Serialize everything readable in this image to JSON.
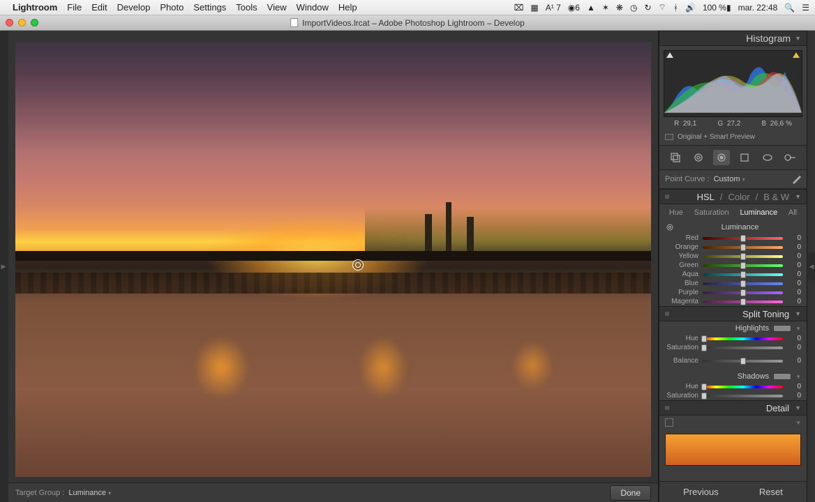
{
  "menubar": {
    "app_name": "Lightroom",
    "items": [
      "File",
      "Edit",
      "Develop",
      "Photo",
      "Settings",
      "Tools",
      "View",
      "Window",
      "Help"
    ],
    "status": {
      "badge1_label": "A¹ 7",
      "badge2_label": "6",
      "battery": "100 %",
      "clock": "mar. 22:48"
    }
  },
  "titlebar": {
    "title": "ImportVideos.lrcat – Adobe Photoshop Lightroom – Develop"
  },
  "image_footer": {
    "target_group_label": "Target Group :",
    "target_group_value": "Luminance",
    "done": "Done"
  },
  "panel_footer": {
    "previous": "Previous",
    "reset": "Reset"
  },
  "histogram": {
    "title": "Histogram",
    "readout": {
      "r_label": "R",
      "r": "29,1",
      "g_label": "G",
      "g": "27,2",
      "b_label": "B",
      "b": "26,6 %"
    },
    "preview_mode": "Original + Smart Preview"
  },
  "point_curve": {
    "label": "Point Curve :",
    "value": "Custom"
  },
  "hsl": {
    "hsl": "HSL",
    "color": "Color",
    "bw": "B & W",
    "tabs": {
      "hue": "Hue",
      "saturation": "Saturation",
      "luminance": "Luminance",
      "all": "All"
    },
    "subhead": "Luminance",
    "sliders": [
      {
        "name": "Red",
        "value": "0",
        "grad": "grad-red"
      },
      {
        "name": "Orange",
        "value": "0",
        "grad": "grad-orange"
      },
      {
        "name": "Yellow",
        "value": "0",
        "grad": "grad-yellow"
      },
      {
        "name": "Green",
        "value": "0",
        "grad": "grad-green"
      },
      {
        "name": "Aqua",
        "value": "0",
        "grad": "grad-aqua"
      },
      {
        "name": "Blue",
        "value": "0",
        "grad": "grad-blue"
      },
      {
        "name": "Purple",
        "value": "0",
        "grad": "grad-purple"
      },
      {
        "name": "Magenta",
        "value": "0",
        "grad": "grad-magenta"
      }
    ]
  },
  "split_toning": {
    "title": "Split Toning",
    "highlights": "Highlights",
    "shadows": "Shadows",
    "hue_label": "Hue",
    "sat_label": "Saturation",
    "balance_label": "Balance",
    "hi_hue": "0",
    "hi_sat": "0",
    "balance": "0",
    "sh_hue": "0",
    "sh_sat": "0"
  },
  "detail": {
    "title": "Detail"
  }
}
